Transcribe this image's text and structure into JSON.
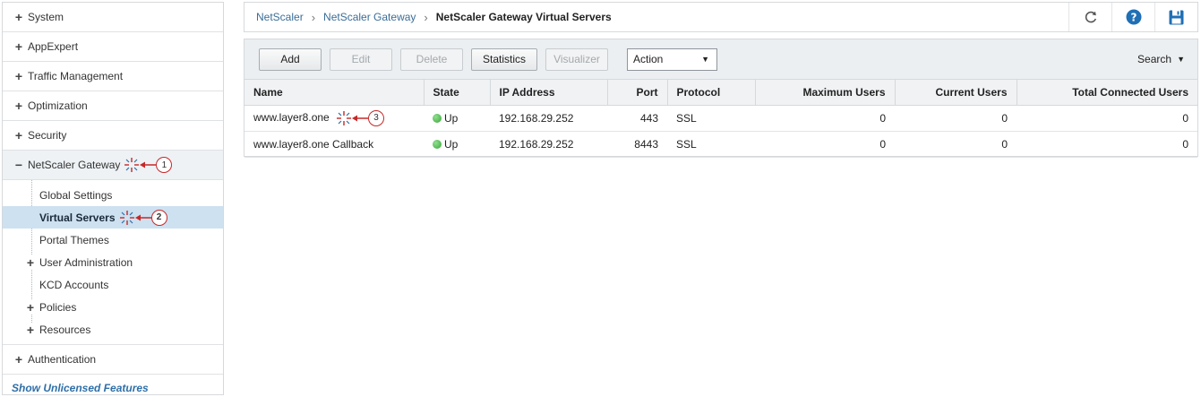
{
  "sidebar": {
    "items_top": [
      {
        "sign": "+",
        "label": "System"
      },
      {
        "sign": "+",
        "label": "AppExpert"
      },
      {
        "sign": "+",
        "label": "Traffic Management"
      },
      {
        "sign": "+",
        "label": "Optimization"
      },
      {
        "sign": "+",
        "label": "Security"
      }
    ],
    "gateway": {
      "sign": "−",
      "label": "NetScaler Gateway",
      "marker": "1"
    },
    "sub_items": [
      {
        "sign": "",
        "label": "Global Settings"
      },
      {
        "sign": "",
        "label": "Virtual Servers",
        "marker": "2"
      },
      {
        "sign": "",
        "label": "Portal Themes"
      },
      {
        "sign": "+",
        "label": "User Administration"
      },
      {
        "sign": "",
        "label": "KCD Accounts"
      },
      {
        "sign": "+",
        "label": "Policies"
      },
      {
        "sign": "+",
        "label": "Resources"
      }
    ],
    "authentication": {
      "sign": "+",
      "label": "Authentication"
    },
    "footer": "Show Unlicensed Features"
  },
  "breadcrumb": {
    "items": [
      "NetScaler",
      "NetScaler Gateway"
    ],
    "separator": "›",
    "current": "NetScaler Gateway Virtual Servers"
  },
  "top_icons": {
    "refresh": "refresh-icon",
    "help": "help-icon",
    "save": "save-icon"
  },
  "toolbar": {
    "add": "Add",
    "edit": "Edit",
    "delete": "Delete",
    "statistics": "Statistics",
    "visualizer": "Visualizer",
    "action": "Action",
    "search": "Search"
  },
  "table": {
    "columns": [
      "Name",
      "State",
      "IP Address",
      "Port",
      "Protocol",
      "Maximum Users",
      "Current Users",
      "Total Connected Users"
    ],
    "rows": [
      {
        "name": "www.layer8.one",
        "marker": "3",
        "state": "Up",
        "ip": "192.168.29.252",
        "port": "443",
        "protocol": "SSL",
        "max_users": "0",
        "current_users": "0",
        "total_connected": "0"
      },
      {
        "name": "www.layer8.one Callback",
        "state": "Up",
        "ip": "192.168.29.252",
        "port": "8443",
        "protocol": "SSL",
        "max_users": "0",
        "current_users": "0",
        "total_connected": "0"
      }
    ]
  },
  "colors": {
    "accent": "#3a6d97",
    "selected_bg": "#cde1f0",
    "annotation_red": "#c62828",
    "status_up": "#3aa43a"
  }
}
